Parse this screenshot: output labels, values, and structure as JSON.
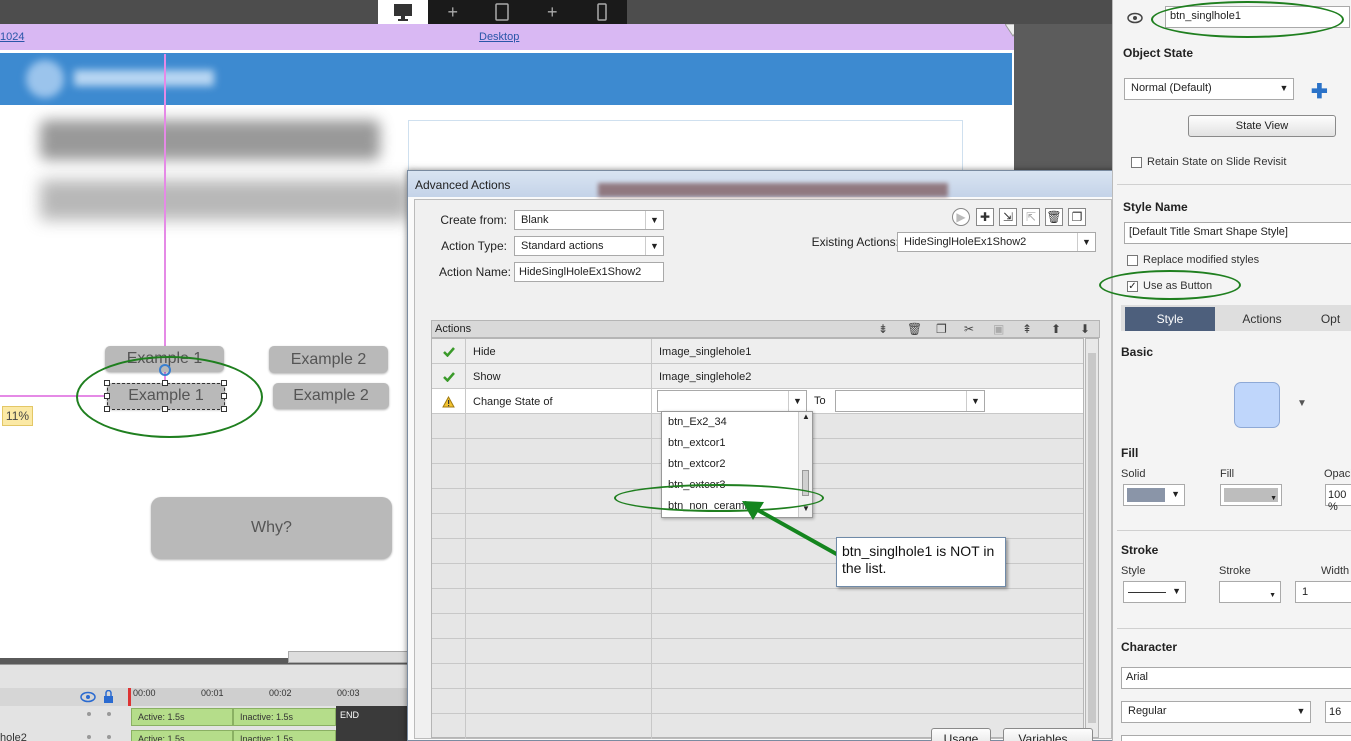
{
  "topbar": {
    "breakpoint_left": "1024",
    "breakpoint_mid": "Desktop",
    "add1": "+",
    "add2": "+"
  },
  "stage": {
    "buttons": [
      "Example 1",
      "Example 2",
      "Example 1",
      "Example 2"
    ],
    "why": "Why?",
    "zoom_badge": "11%"
  },
  "timeline": {
    "ticks": [
      "00:00",
      "00:01",
      "00:02",
      "00:03"
    ],
    "bar_active": "Active: 1.5s",
    "bar_inactive": "Inactive: 1.5s",
    "bar_active2": "Active: 1.5s",
    "bar_inactive2": "Inactive: 1.5s",
    "end": "END",
    "row_name": "hole2"
  },
  "dialog": {
    "title": "Advanced Actions",
    "create_from_label": "Create from:",
    "create_from_value": "Blank",
    "action_type_label": "Action Type:",
    "action_type_value": "Standard actions",
    "action_name_label": "Action Name:",
    "action_name_value": "HideSinglHoleEx1Show2",
    "existing_label": "Existing Actions:",
    "existing_value": "HideSinglHoleEx1Show2",
    "actions_header": "Actions",
    "rows": [
      {
        "status": "check",
        "action": "Hide",
        "target": "Image_singlehole1"
      },
      {
        "status": "check",
        "action": "Show",
        "target": "Image_singlehole2"
      },
      {
        "status": "warning",
        "action": "Change State of",
        "target": ""
      }
    ],
    "to_label": "To",
    "dropdown_items": [
      "btn_Ex2_34",
      "btn_extcor1",
      "btn_extcor2",
      "btn_extcor3",
      "btn_non_ceramic"
    ],
    "usage_button": "Usage",
    "variables_button": "Variables..."
  },
  "callout": {
    "text": "btn_singlhole1 is NOT in the list."
  },
  "properties": {
    "name_value": "btn_singlhole1",
    "object_state_heading": "Object State",
    "state_value": "Normal (Default)",
    "state_view_button": "State View",
    "retain_state": "Retain State on Slide Revisit",
    "style_name_heading": "Style Name",
    "style_value": "[Default Title Smart Shape Style]",
    "replace_modified": "Replace modified styles",
    "use_as_button": "Use as Button",
    "tabs": [
      "Style",
      "Actions",
      "Opt"
    ],
    "basic_heading": "Basic",
    "fill_heading": "Fill",
    "fill_solid_label": "Solid",
    "fill_label": "Fill",
    "opacity_label": "Opaci",
    "opacity_value": "100 %",
    "stroke_heading": "Stroke",
    "stroke_style_label": "Style",
    "stroke_label": "Stroke",
    "stroke_width_label": "Width",
    "stroke_width_value": "1",
    "character_heading": "Character",
    "font_value": "Arial",
    "font_style_value": "Regular",
    "font_size_value": "16"
  },
  "colors": {
    "highlight_green": "#1f7f1f",
    "arrow_green": "#14851e",
    "shape_fill": "#bfd6fb"
  }
}
